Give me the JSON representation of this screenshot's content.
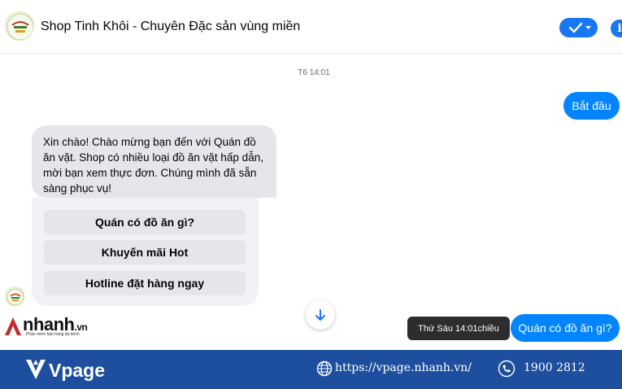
{
  "header": {
    "shop_name": "Shop Tinh Khôi - Chuyên Đặc sản vùng miền",
    "info_icon": "i"
  },
  "conversation": {
    "timestamp": "T6 14:01",
    "outgoing_1": "Bắt đầu",
    "incoming_message": "Xin chào! Chào mừng bạn đến với Quán đồ ăn vặt. Shop có nhiều loại đồ ăn vặt hấp dẫn, mời bạn xem thực đơn. Chúng mình đã sẵn sàng phục vụ!",
    "quick_replies": [
      {
        "label": "Quán có đồ ăn gì?"
      },
      {
        "label": "Khuyến mãi Hot"
      },
      {
        "label": "Hotline đặt hàng ngay"
      }
    ],
    "outgoing_2": "Quán có đồ ăn gì?",
    "tooltip": "Thứ Sáu 14:01chiều"
  },
  "watermark": {
    "brand": "nhanh",
    "brand_suffix": ".vn",
    "tagline": "Phần mềm bán hàng đa kênh"
  },
  "footer": {
    "brand": "Vpage",
    "url": "https://vpage.nhanh.vn/",
    "phone": "1900 2812"
  },
  "colors": {
    "accent": "#0084ff",
    "footer_bg": "#1e4f9e",
    "bubble_in": "#e4e6eb"
  }
}
